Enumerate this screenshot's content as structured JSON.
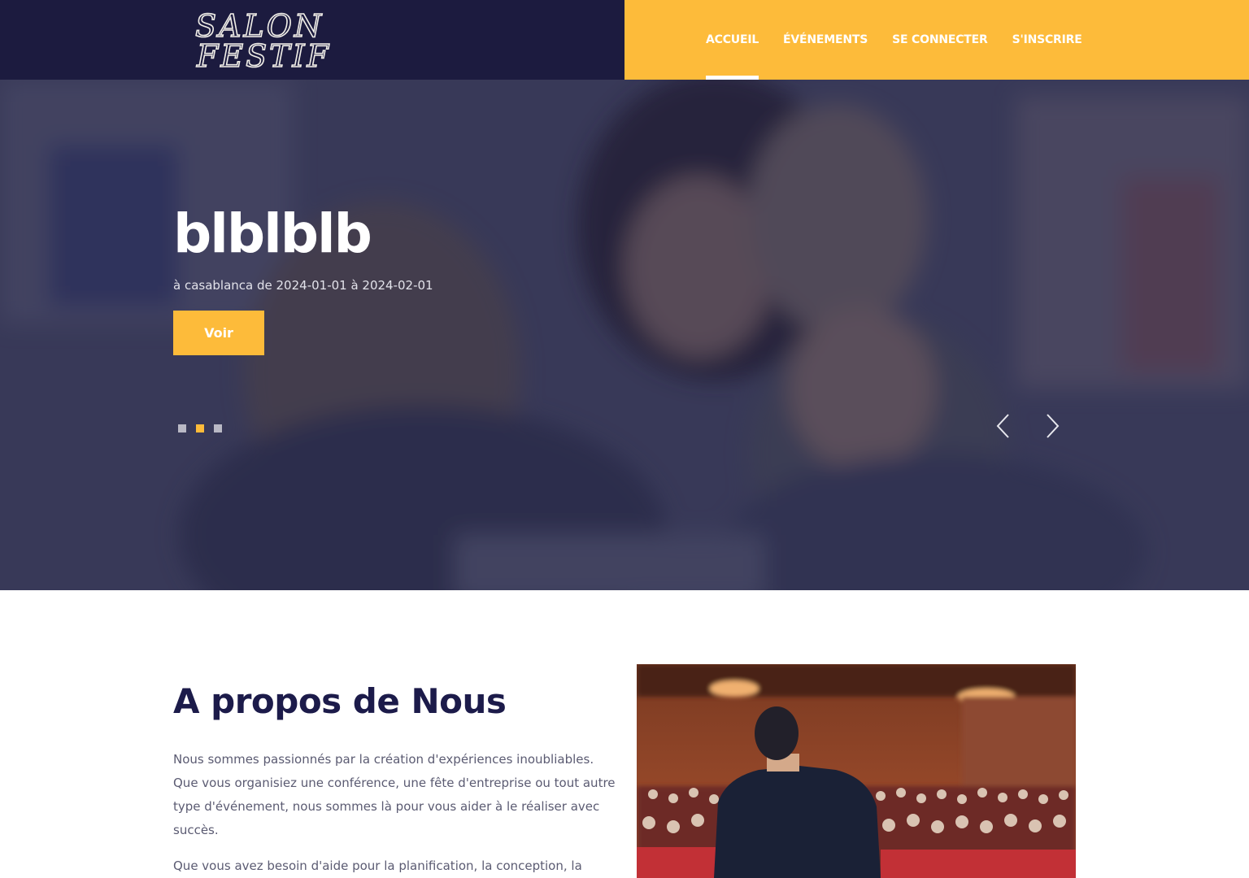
{
  "brand": {
    "logo_line1": "SALON",
    "logo_line2": "FESTIF"
  },
  "nav": {
    "items": [
      {
        "label": "ACCUEIL",
        "active": true
      },
      {
        "label": "ÉVÉNEMENTS",
        "active": false
      },
      {
        "label": "SE CONNECTER",
        "active": false
      },
      {
        "label": "S'INSCRIRE",
        "active": false
      }
    ]
  },
  "hero": {
    "title": "blblblb",
    "subtitle": "à casablanca de 2024-01-01 à 2024-02-01",
    "button_label": "Voir",
    "slides_count": 3,
    "active_slide": 2,
    "prev_icon": "chevron-left-icon",
    "next_icon": "chevron-right-icon"
  },
  "about": {
    "title": "A propos de Nous",
    "paragraphs": [
      "Nous sommes passionnés par la création d'expériences inoubliables. Que vous organisiez une conférence, une fête d'entreprise ou tout autre type d'événement, nous sommes là pour vous aider à le réaliser avec succès.",
      "Que vous avez besoin d'aide pour la planification, la conception, la"
    ]
  },
  "colors": {
    "navy": "#1c1b3f",
    "accent": "#fdbb3a",
    "heading": "#1c1b4a",
    "body_text": "#5b5b72"
  }
}
